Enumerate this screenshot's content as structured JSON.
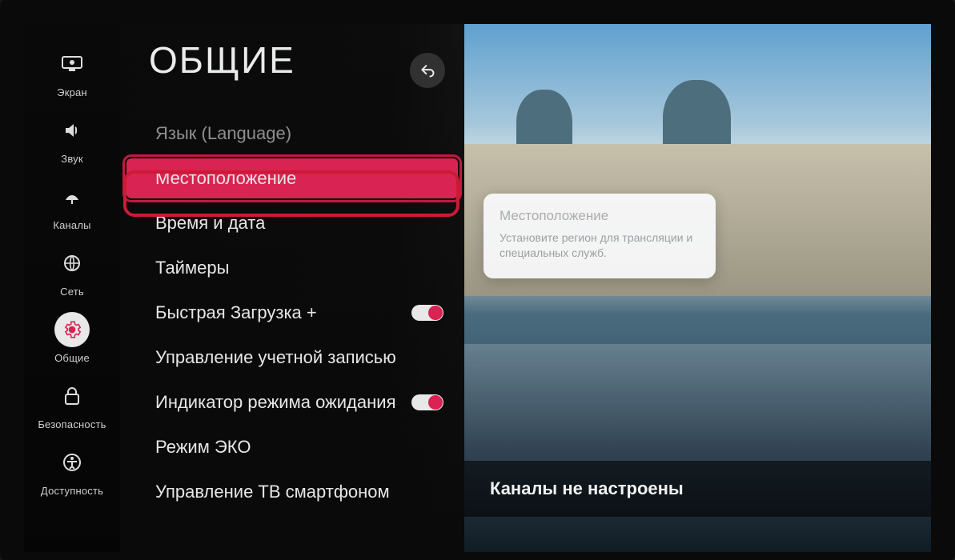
{
  "sidebar": {
    "items": [
      {
        "name": "screen",
        "label": "Экран"
      },
      {
        "name": "sound",
        "label": "Звук"
      },
      {
        "name": "channels",
        "label": "Каналы"
      },
      {
        "name": "network",
        "label": "Сеть"
      },
      {
        "name": "general",
        "label": "Общие",
        "selected": true
      },
      {
        "name": "safety",
        "label": "Безопасность"
      },
      {
        "name": "accessibility",
        "label": "Доступность"
      }
    ]
  },
  "settings": {
    "title": "ОБЩИЕ",
    "selectedIndex": 1,
    "items": [
      {
        "label": "Язык (Language)"
      },
      {
        "label": "Местоположение",
        "selected": true
      },
      {
        "label": "Время и дата"
      },
      {
        "label": "Таймеры"
      },
      {
        "label": "Быстрая Загрузка +",
        "toggle": true,
        "value": true
      },
      {
        "label": "Управление учетной записью"
      },
      {
        "label": "Индикатор режима ожидания",
        "toggle": true,
        "value": true
      },
      {
        "label": "Режим ЭКО"
      },
      {
        "label": "Управление ТВ смартфоном"
      }
    ]
  },
  "infoCard": {
    "title": "Местоположение",
    "body": "Установите регион для трансляции и специальных служб."
  },
  "statusBanner": "Каналы не настроены",
  "colors": {
    "accent": "#d92352"
  }
}
